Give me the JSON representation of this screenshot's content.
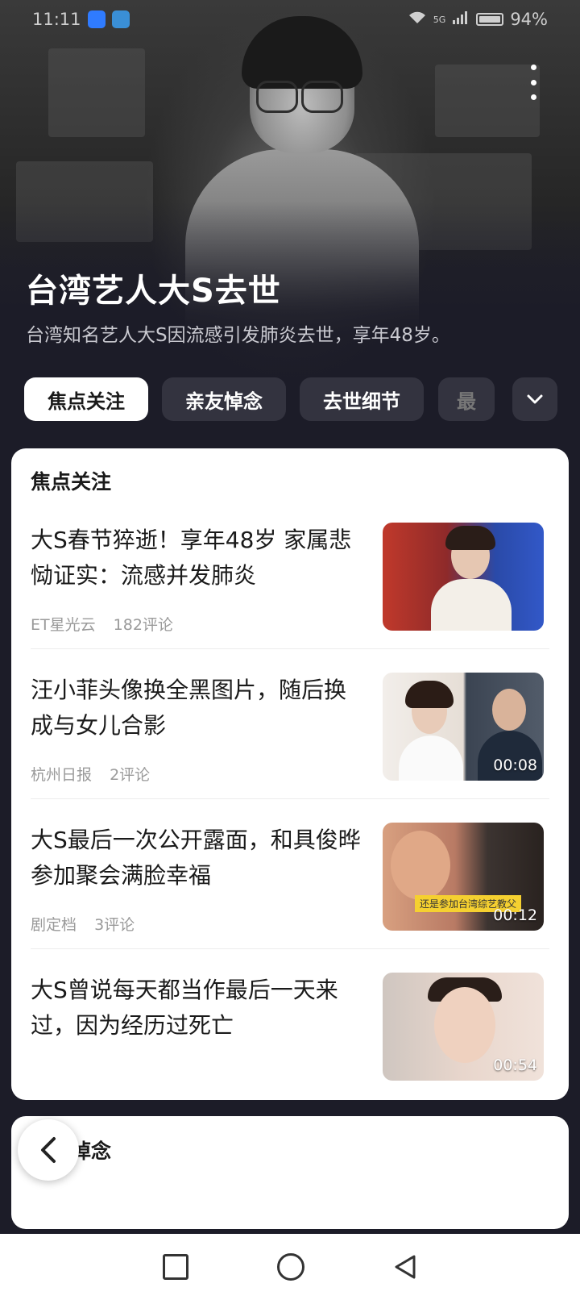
{
  "status_bar": {
    "time": "11:11",
    "network": "5G",
    "battery": "94%"
  },
  "hero": {
    "title": "台湾艺人大S去世",
    "subtitle": "台湾知名艺人大S因流感引发肺炎去世，享年48岁。"
  },
  "tabs": [
    {
      "label": "焦点关注",
      "active": true
    },
    {
      "label": "亲友悼念",
      "active": false
    },
    {
      "label": "去世细节",
      "active": false
    },
    {
      "label": "最",
      "active": false
    }
  ],
  "focus_section": {
    "title": "焦点关注",
    "items": [
      {
        "title": "大S春节猝逝！享年48岁 家属悲恸证实：流感并发肺炎",
        "source": "ET星光云",
        "comments": "182评论",
        "duration": ""
      },
      {
        "title": "汪小菲头像换全黑图片，随后换成与女儿合影",
        "source": "杭州日报",
        "comments": "2评论",
        "duration": "00:08"
      },
      {
        "title": "大S最后一次公开露面，和具俊晔参加聚会满脸幸福",
        "source": "剧定档",
        "comments": "3评论",
        "duration": "00:12",
        "caption": "还是参加台湾综艺教父"
      },
      {
        "title": "大S曾说每天都当作最后一天来过，因为经历过死亡",
        "source": "",
        "comments": "",
        "duration": "00:54"
      }
    ]
  },
  "second_section": {
    "title": "亲友悼念"
  },
  "icons": {
    "more": "more-vertical-icon",
    "expand": "chevron-down-icon",
    "back": "chevron-left-icon",
    "nav_recent": "square-icon",
    "nav_home": "circle-icon",
    "nav_back": "triangle-back-icon"
  }
}
